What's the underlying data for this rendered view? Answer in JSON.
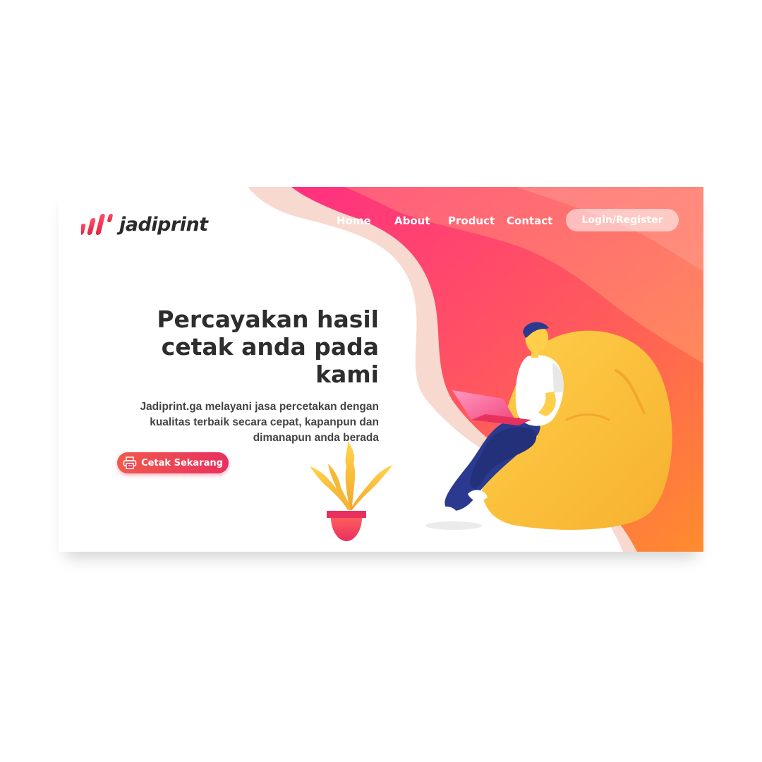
{
  "brand": {
    "name": "jadiprint"
  },
  "nav": {
    "items": [
      {
        "label": "Home"
      },
      {
        "label": "About"
      },
      {
        "label": "Product"
      },
      {
        "label": "Contact"
      }
    ],
    "login_label": "Login/Register"
  },
  "hero": {
    "headline_line1": "Percayakan hasil",
    "headline_line2": "cetak anda pada kami",
    "sub_line1": "Jadiprint.ga melayani jasa percetakan dengan",
    "sub_line2": "kualitas terbaik secara cepat, kapanpun dan",
    "sub_line3": "dimanapun anda berada",
    "cta_label": "Cetak Sekarang"
  },
  "colors": {
    "accent_pink": "#ff3d7f",
    "accent_orange": "#ff8a3d",
    "beanbag_yellow": "#fbbf45",
    "button_red": "#e8305f"
  },
  "icons": {
    "logo": "jadiprint-logo-bars",
    "cta": "printer-icon"
  }
}
